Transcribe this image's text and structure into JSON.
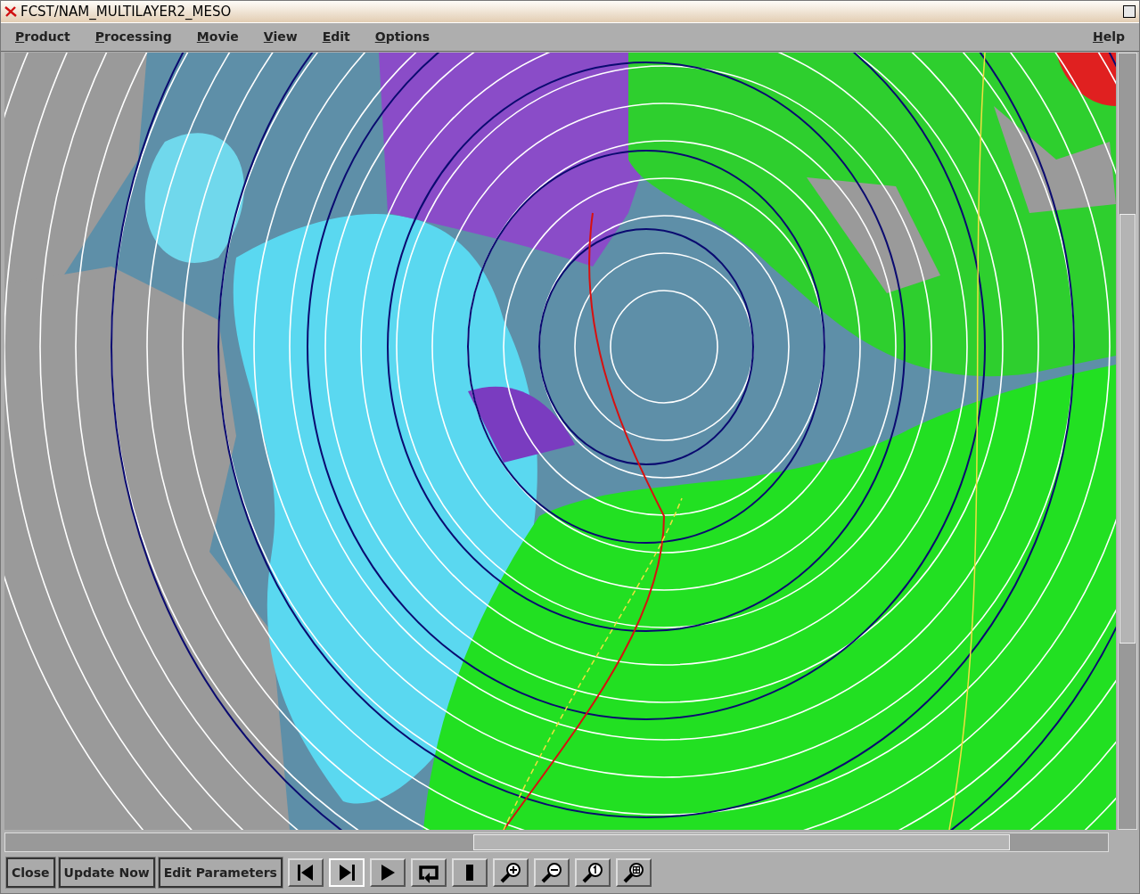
{
  "window": {
    "title": "FCST/NAM_MULTILAYER2_MESO"
  },
  "menu": {
    "items": [
      "Product",
      "Processing",
      "Movie",
      "View",
      "Edit",
      "Options"
    ],
    "help": "Help"
  },
  "buttons": [
    "Close",
    "Update Now",
    "Edit Parameters"
  ],
  "toolbar": [
    {
      "kind": "first",
      "selected": false
    },
    {
      "kind": "last",
      "selected": true
    },
    {
      "kind": "play",
      "selected": false
    },
    {
      "kind": "loop",
      "selected": false
    },
    {
      "kind": "stop",
      "selected": false
    },
    {
      "kind": "zoom-in",
      "selected": false
    },
    {
      "kind": "zoom-out",
      "selected": false
    },
    {
      "kind": "zoom-one",
      "selected": false
    },
    {
      "kind": "zoom-fit",
      "selected": false
    }
  ]
}
